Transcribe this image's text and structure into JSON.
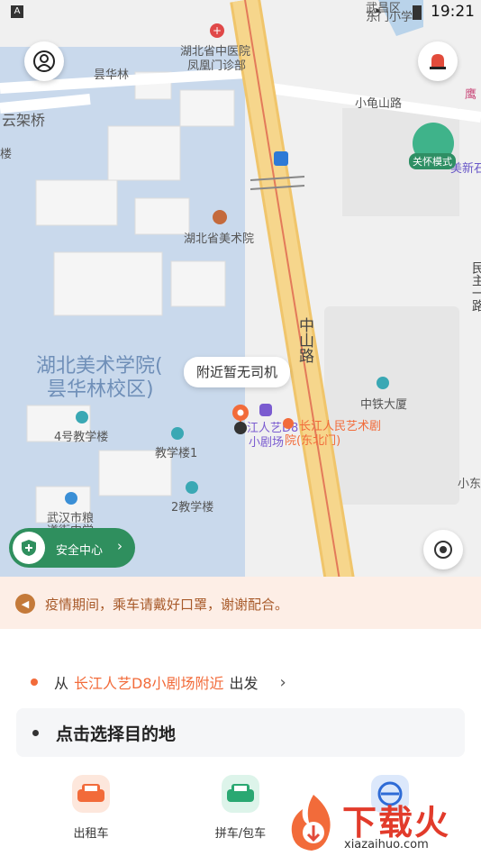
{
  "status_bar": {
    "time": "19:21",
    "left_badge": "A"
  },
  "map": {
    "labels": {
      "hospital": "湖北省中医院",
      "hospital_sub": "凤凰门诊部",
      "yunhualin": "昙华林",
      "yunjiaqiao": "云架桥",
      "left_edge": "楼",
      "xiaoguishan": "小龟山路",
      "museum": "湖北省美术院",
      "academy_line1": "湖北美术学院(",
      "academy_line2": "昙华林校区)",
      "zhongshan": "中山路",
      "building4": "4号教学楼",
      "building1": "教学楼1",
      "building2": "2教学楼",
      "wuhan_grain": "武汉市粮",
      "wuhan_grain2": "道街中学",
      "crcc": "中铁大厦",
      "changjiang_grey": "江人艺D8",
      "changjiang_grey2": "小剧场",
      "changjiang_orange": "长江人民艺术剧",
      "changjiang_orange2": "院(东北门)",
      "minzhu": "民主一路",
      "top_right_a": "武昌区",
      "top_right_b": "东门小学",
      "eagle": "鹰",
      "new_stone": "美新石",
      "xiaodong": "小东"
    },
    "care_mode": "关怀模式",
    "driver_bubble": "附近暂无司机",
    "safety_center": "安全中心"
  },
  "notice": {
    "text": "疫情期间，乘车请戴好口罩，谢谢配合。"
  },
  "panel": {
    "from_prefix": "从",
    "from_place": "长江人艺D8小剧场附近",
    "from_suffix": "出发",
    "destination_placeholder": "点击选择目的地",
    "services": [
      {
        "label": "出租车",
        "color": "#f26b3a"
      },
      {
        "label": "拼车/包车",
        "color": "#2aa872"
      },
      {
        "label": "",
        "color": "#2e6bd6"
      }
    ]
  },
  "watermark": {
    "text": "下载火",
    "url": "xiazaihuo.com"
  },
  "colors": {
    "accent": "#f26b3a",
    "safety": "#2f8f5e",
    "road": "#f6d68c"
  }
}
